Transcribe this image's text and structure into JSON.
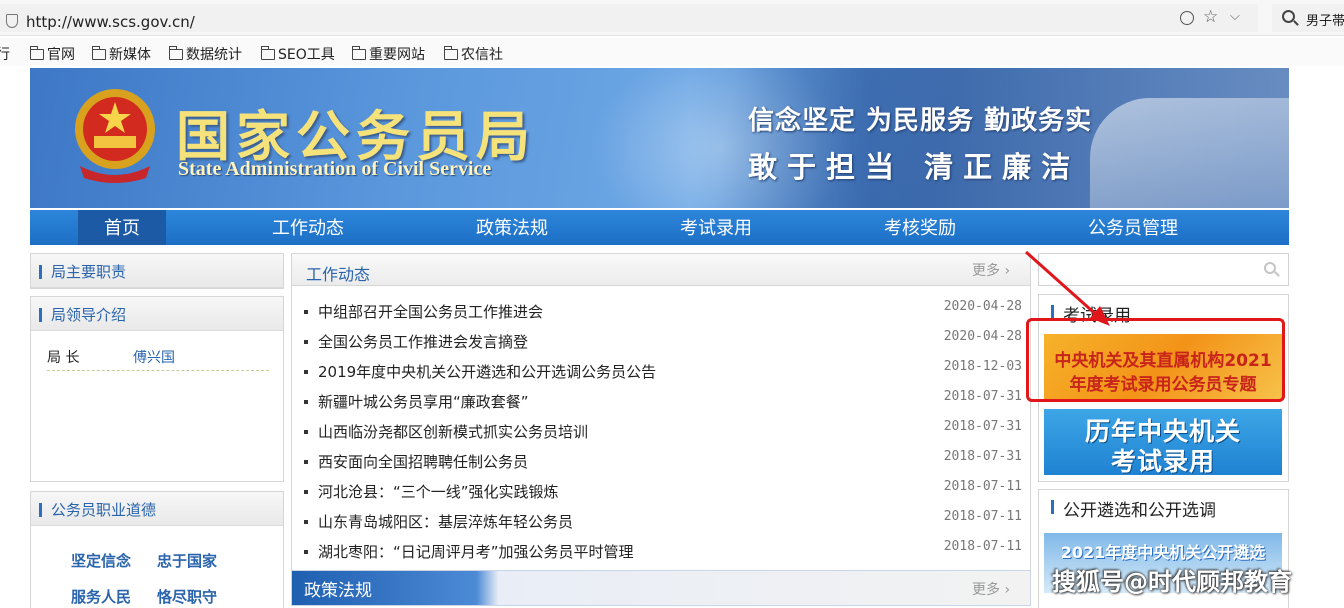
{
  "browser": {
    "url": "http://www.scs.gov.cn/",
    "search_text": "男子帯",
    "bookmarks": [
      "行",
      "官网",
      "新媒体",
      "数据统计",
      "SEO工具",
      "重要网站",
      "农信社"
    ]
  },
  "banner": {
    "logo_cn": "国家公务员局",
    "logo_en": "State Administration of Civil Service",
    "slogan_line1": "信念坚定  为民服务  勤政务实",
    "slogan_line2": "敢于担当  清正廉洁"
  },
  "nav": {
    "items": [
      "首页",
      "工作动态",
      "政策法规",
      "考试录用",
      "考核奖励",
      "公务员管理"
    ],
    "active_index": 0
  },
  "left": {
    "duties_title": "局主要职责",
    "leaders_title": "局领导介绍",
    "leader_role": "局  长",
    "leader_name": "傅兴国",
    "ethics_title": "公务员职业道德",
    "ethics": [
      "坚定信念",
      "忠于国家",
      "服务人民",
      "恪尽职守"
    ]
  },
  "main": {
    "news_title": "工作动态",
    "more_label": "更多",
    "news": [
      {
        "title": "中组部召开全国公务员工作推进会",
        "date": "2020-04-28"
      },
      {
        "title": "全国公务员工作推进会发言摘登",
        "date": "2020-04-28"
      },
      {
        "title": "2019年度中央机关公开遴选和公开选调公务员公告",
        "date": "2018-12-03"
      },
      {
        "title": "新疆叶城公务员享用“廉政套餐”",
        "date": "2018-07-31"
      },
      {
        "title": "山西临汾尧都区创新模式抓实公务员培训",
        "date": "2018-07-31"
      },
      {
        "title": "西安面向全国招聘聘任制公务员",
        "date": "2018-07-31"
      },
      {
        "title": "河北沧县：“三个一线”强化实践锻炼",
        "date": "2018-07-11"
      },
      {
        "title": "山东青岛城阳区：基层淬炼年轻公务员",
        "date": "2018-07-11"
      },
      {
        "title": "湖北枣阳：“日记周评月考”加强公务员平时管理",
        "date": "2018-07-11"
      }
    ],
    "policy_title": "政策法规",
    "policy_more": "更多"
  },
  "right": {
    "exam_title": "考试录用",
    "exam_banner_line1": "中央机关及其直属机构2021",
    "exam_banner_line2": "年度考试录用公务员专题",
    "history_line1": "历年中央机关",
    "history_line2": "考试录用",
    "selection_title": "公开遴选和公开选调",
    "selection_banner": "2021年度中央机关公开遴选"
  },
  "watermark": "搜狐号@时代顾邦教育",
  "colors": {
    "nav_blue": "#1f74c9",
    "link_blue": "#2a64ac",
    "highlight_red": "#e0161b"
  }
}
